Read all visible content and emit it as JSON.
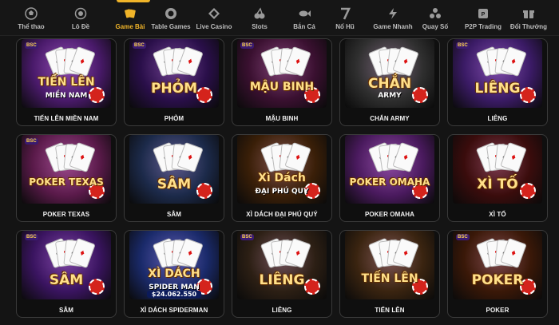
{
  "nav": {
    "items": [
      {
        "label": "Thể thao",
        "icon": "soccer-ball-icon"
      },
      {
        "label": "Lô Đề",
        "icon": "lottery-ball-icon"
      },
      {
        "label": "Game Bài",
        "icon": "card-game-icon"
      },
      {
        "label": "Table Games",
        "icon": "casino-chip-icon"
      },
      {
        "label": "Live Casino",
        "icon": "diamond-icon"
      },
      {
        "label": "Slots",
        "icon": "cherry-icon"
      },
      {
        "label": "Bắn Cá",
        "icon": "fish-icon"
      },
      {
        "label": "Nổ Hũ",
        "icon": "number-seven-icon"
      },
      {
        "label": "Game Nhanh",
        "icon": "lightning-icon"
      },
      {
        "label": "Quay Số",
        "icon": "lottery-balls-icon"
      },
      {
        "label": "P2P Trading",
        "icon": "p2p-icon"
      },
      {
        "label": "Đổi Thưởng",
        "icon": "reward-icon"
      }
    ],
    "active_index": 2,
    "accent": "#f0b429"
  },
  "games": [
    {
      "label": "TIẾN LÊN MIỀN NAM",
      "logo": "TIẾN LÊN",
      "logo2": "MIỀN NAM",
      "bg": "#4a1a6b",
      "tile": "tien-len-mien-nam"
    },
    {
      "label": "PHỎM",
      "logo": "PHỎM",
      "logo2": "",
      "bg": "#2a0f4a",
      "tile": "phom"
    },
    {
      "label": "MẬU BINH",
      "logo": "MẬU BINH",
      "logo2": "",
      "bg": "#3a1030",
      "tile": "mau-binh"
    },
    {
      "label": "CHẮN ARMY",
      "logo": "CHẮN",
      "logo2": "ARMY",
      "bg": "#2f2f2f",
      "tile": "chan-army"
    },
    {
      "label": "LIÊNG",
      "logo": "LIÊNG",
      "logo2": "",
      "bg": "#3b1b66",
      "tile": "lieng"
    },
    {
      "label": "POKER TEXAS",
      "logo": "POKER TEXAS",
      "logo2": "",
      "bg": "#5a1a4a",
      "tile": "poker-texas"
    },
    {
      "label": "SÂM",
      "logo": "SÂM",
      "logo2": "",
      "bg": "#1c2a4a",
      "tile": "sam"
    },
    {
      "label": "XÌ DÁCH ĐẠI PHÚ QUÝ",
      "logo": "Xì Dách",
      "logo2": "ĐẠI PHÚ QUÝ",
      "bg": "#3a1f08",
      "tile": "xi-dach-dai-phu-quy"
    },
    {
      "label": "POKER OMAHA",
      "logo": "POKER OMAHA",
      "logo2": "",
      "bg": "#4a1a5e",
      "tile": "poker-omaha"
    },
    {
      "label": "XÌ TỐ",
      "logo": "XÌ TỐ",
      "logo2": "",
      "bg": "#3a0c0c",
      "tile": "xi-to"
    },
    {
      "label": "SÂM",
      "logo": "SÂM",
      "logo2": "",
      "bg": "#3a1460",
      "tile": "sam-2"
    },
    {
      "label": "XÌ DÁCH SPIDERMAN",
      "logo": "XÌ DÁCH",
      "logo2": "SPIDER MAN",
      "bg": "#1a2a6a",
      "tile": "xi-dach-spiderman"
    },
    {
      "label": "LIÊNG",
      "logo": "LIÊNG",
      "logo2": "",
      "bg": "#2c1f14",
      "tile": "lieng-2"
    },
    {
      "label": "TIẾN LÊN",
      "logo": "TIẾN LÊN",
      "logo2": "",
      "bg": "#3a2410",
      "tile": "tien-len"
    },
    {
      "label": "POKER",
      "logo": "POKER",
      "logo2": "",
      "bg": "#3a1808",
      "tile": "poker"
    }
  ],
  "jackpot": "$24.062.550",
  "badge": "BSC"
}
